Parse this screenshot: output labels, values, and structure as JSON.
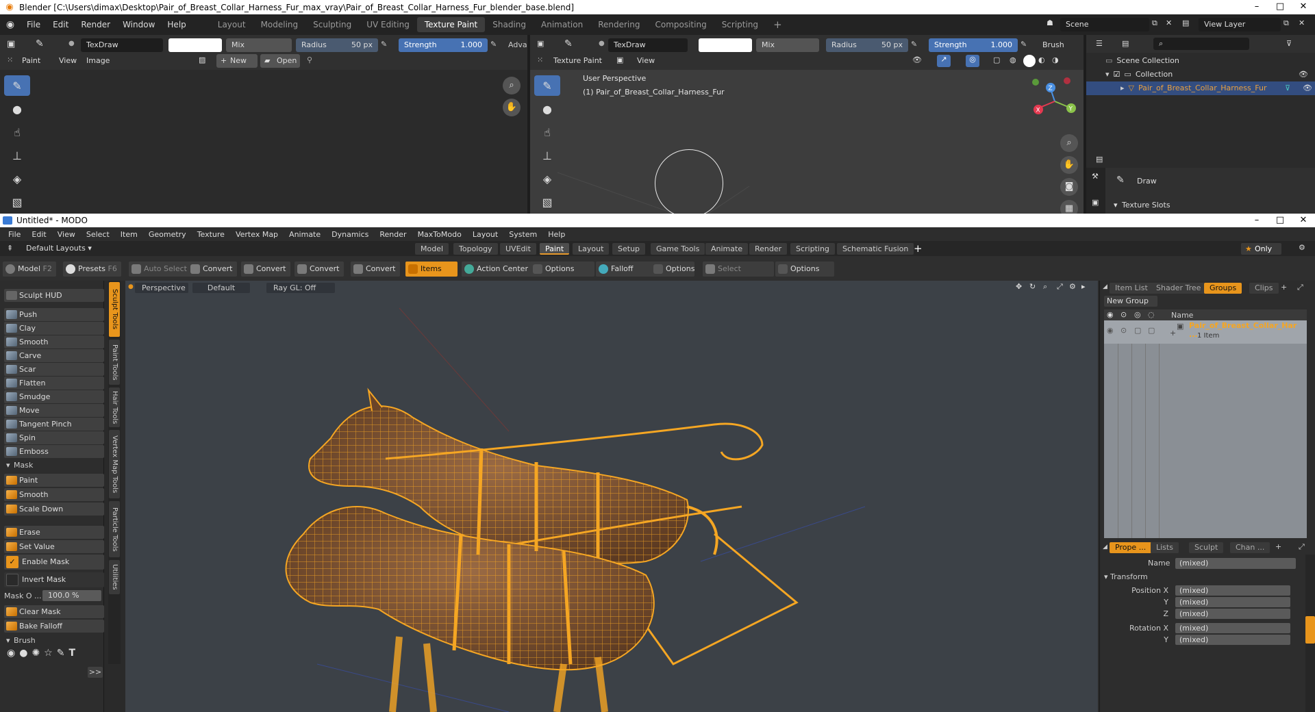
{
  "blender": {
    "title": "Blender [C:\\Users\\dimax\\Desktop\\Pair_of_Breast_Collar_Harness_Fur_max_vray\\Pair_of_Breast_Collar_Harness_Fur_blender_base.blend]",
    "menu": [
      "File",
      "Edit",
      "Render",
      "Window",
      "Help"
    ],
    "workspaces": [
      "Layout",
      "Modeling",
      "Sculpting",
      "UV Editing",
      "Texture Paint",
      "Shading",
      "Animation",
      "Rendering",
      "Compositing",
      "Scripting"
    ],
    "active_workspace": "Texture Paint",
    "scene": "Scene",
    "view_layer": "View Layer",
    "image_editor": {
      "brush": "TexDraw",
      "blend": "Mix",
      "radius_label": "Radius",
      "radius_value": "50 px",
      "strength_label": "Strength",
      "strength_value": "1.000",
      "adv": "Adva",
      "mode": "Paint",
      "view": "View",
      "image": "Image",
      "new": "New",
      "open": "Open"
    },
    "viewport": {
      "brush": "TexDraw",
      "blend": "Mix",
      "radius_label": "Radius",
      "radius_value": "50 px",
      "strength_label": "Strength",
      "strength_value": "1.000",
      "brush_menu": "Brush",
      "mode": "Texture Paint",
      "view": "View",
      "perspective": "User Perspective",
      "object": "(1) Pair_of_Breast_Collar_Harness_Fur",
      "gizmo": {
        "x": "X",
        "y": "Y",
        "z": "Z"
      }
    },
    "outliner": {
      "scene_collection": "Scene Collection",
      "collection": "Collection",
      "object": "Pair_of_Breast_Collar_Harness_Fur"
    },
    "properties": {
      "tool": "Draw",
      "texture_slots": "Texture Slots"
    }
  },
  "modo": {
    "title": "Untitled* - MODO",
    "menu": [
      "File",
      "Edit",
      "View",
      "Select",
      "Item",
      "Geometry",
      "Texture",
      "Vertex Map",
      "Animate",
      "Dynamics",
      "Render",
      "MaxToModo",
      "Layout",
      "System",
      "Help"
    ],
    "layout_selector": "Default Layouts",
    "layout_tabs": [
      "Model",
      "Topology",
      "UVEdit",
      "Paint",
      "Layout",
      "Setup",
      "Game Tools",
      "Animate",
      "Render",
      "Scripting",
      "Schematic Fusion"
    ],
    "active_tab": "Paint",
    "only": "Only",
    "toolbar": {
      "model": "Model",
      "model_key": "F2",
      "presets": "Presets",
      "presets_key": "F6",
      "auto_select": "Auto Select",
      "convert1": "Convert",
      "convert2": "Convert",
      "convert3": "Convert",
      "convert4": "Convert",
      "items": "Items",
      "action_center": "Action Center",
      "options1": "Options",
      "falloff": "Falloff",
      "options2": "Options",
      "select_through": "Select Through",
      "options3": "Options"
    },
    "left_panel": {
      "sculpt_hud": "Sculpt HUD",
      "tools": [
        "Push",
        "Clay",
        "Smooth",
        "Carve",
        "Scar",
        "Flatten",
        "Smudge",
        "Move",
        "Tangent Pinch",
        "Spin",
        "Emboss"
      ],
      "mask_label": "Mask",
      "mask_tools": [
        "Paint",
        "Smooth",
        "Scale Down"
      ],
      "erase": "Erase",
      "set_value": "Set Value",
      "enable_mask": "Enable Mask",
      "invert_mask": "Invert Mask",
      "mask_opacity_label": "Mask O ...",
      "mask_opacity_value": "100.0 %",
      "clear_mask": "Clear Mask",
      "bake_falloff": "Bake Falloff",
      "brush_label": "Brush",
      "more": ">>"
    },
    "side_tabs": [
      "Sculpt Tools",
      "Paint Tools",
      "Hair Tools",
      "Vertex Map Tools",
      "Particle Tools",
      "Utilities"
    ],
    "viewport": {
      "view": "Perspective",
      "style": "Default",
      "raygl": "Ray GL: Off"
    },
    "right_panel": {
      "tabs": [
        "Item List",
        "Shader Tree",
        "Groups",
        "Clips"
      ],
      "active_tab": "Groups",
      "new_group": "New Group",
      "name_col": "Name",
      "group_name": "Pair_of_Breast_Collar_Har ...",
      "group_count": "1 Item",
      "prop_tabs": [
        "Prope ...",
        "Lists",
        "Sculpt",
        "Chan ..."
      ],
      "name_label": "Name",
      "name_value": "(mixed)",
      "transform": "Transform",
      "props": [
        {
          "label": "Position X",
          "value": "(mixed)"
        },
        {
          "label": "Y",
          "value": "(mixed)"
        },
        {
          "label": "Z",
          "value": "(mixed)"
        },
        {
          "label": "Rotation X",
          "value": "(mixed)"
        },
        {
          "label": "Y",
          "value": "(mixed)"
        }
      ]
    }
  },
  "colors": {
    "blender_accent": "#4772b3",
    "modo_accent": "#e8951c",
    "wireframe": "#f5a623"
  }
}
